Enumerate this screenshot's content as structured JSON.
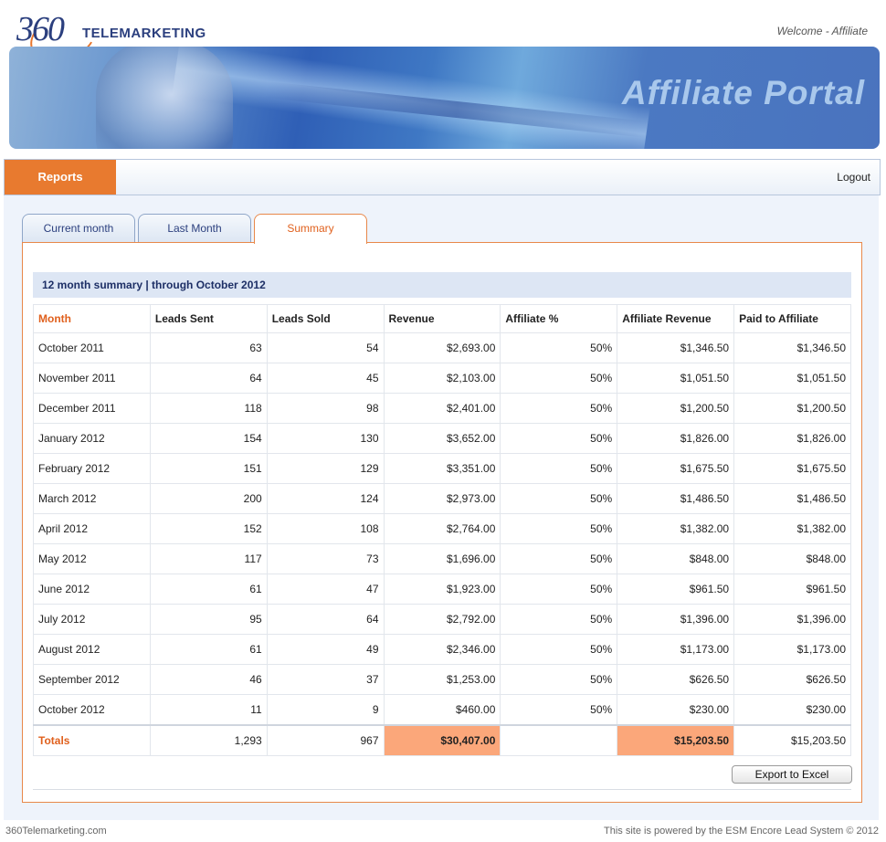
{
  "header": {
    "logo_number": "360",
    "logo_word": "TELEMARKETING",
    "welcome": "Welcome - Affiliate",
    "banner_title": "Affiliate Portal"
  },
  "nav": {
    "reports": "Reports",
    "logout": "Logout"
  },
  "tabs": [
    {
      "label": "Current month",
      "active": false
    },
    {
      "label": "Last Month",
      "active": false
    },
    {
      "label": "Summary",
      "active": true
    }
  ],
  "summary": {
    "title": "12 month summary | through October 2012",
    "columns": [
      "Month",
      "Leads Sent",
      "Leads Sold",
      "Revenue",
      "Affiliate %",
      "Affiliate Revenue",
      "Paid to Affiliate"
    ],
    "rows": [
      [
        "October 2011",
        "63",
        "54",
        "$2,693.00",
        "50%",
        "$1,346.50",
        "$1,346.50"
      ],
      [
        "November 2011",
        "64",
        "45",
        "$2,103.00",
        "50%",
        "$1,051.50",
        "$1,051.50"
      ],
      [
        "December 2011",
        "118",
        "98",
        "$2,401.00",
        "50%",
        "$1,200.50",
        "$1,200.50"
      ],
      [
        "January 2012",
        "154",
        "130",
        "$3,652.00",
        "50%",
        "$1,826.00",
        "$1,826.00"
      ],
      [
        "February 2012",
        "151",
        "129",
        "$3,351.00",
        "50%",
        "$1,675.50",
        "$1,675.50"
      ],
      [
        "March 2012",
        "200",
        "124",
        "$2,973.00",
        "50%",
        "$1,486.50",
        "$1,486.50"
      ],
      [
        "April 2012",
        "152",
        "108",
        "$2,764.00",
        "50%",
        "$1,382.00",
        "$1,382.00"
      ],
      [
        "May 2012",
        "117",
        "73",
        "$1,696.00",
        "50%",
        "$848.00",
        "$848.00"
      ],
      [
        "June 2012",
        "61",
        "47",
        "$1,923.00",
        "50%",
        "$961.50",
        "$961.50"
      ],
      [
        "July 2012",
        "95",
        "64",
        "$2,792.00",
        "50%",
        "$1,396.00",
        "$1,396.00"
      ],
      [
        "August 2012",
        "61",
        "49",
        "$2,346.00",
        "50%",
        "$1,173.00",
        "$1,173.00"
      ],
      [
        "September 2012",
        "46",
        "37",
        "$1,253.00",
        "50%",
        "$626.50",
        "$626.50"
      ],
      [
        "October 2012",
        "11",
        "9",
        "$460.00",
        "50%",
        "$230.00",
        "$230.00"
      ]
    ],
    "totals": {
      "label": "Totals",
      "leads_sent": "1,293",
      "leads_sold": "967",
      "revenue": "$30,407.00",
      "affiliate_pct": "",
      "affiliate_revenue": "$15,203.50",
      "paid_to_affiliate": "$15,203.50"
    },
    "highlight_color": "#fba77a"
  },
  "export_label": "Export to Excel",
  "footer": {
    "left": "360Telemarketing.com",
    "right": "This site is powered by the ESM Encore Lead System © 2012"
  }
}
